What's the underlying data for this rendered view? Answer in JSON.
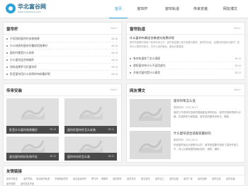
{
  "site": {
    "title": "华北富谷网",
    "url": "www.huabeiwai.com"
  },
  "nav": [
    "首页",
    "窗帘杆",
    "窗帘轨道",
    "传来安装",
    "网友博文"
  ],
  "panels": {
    "top_left": {
      "title": "窗帘杆",
      "more": "More+",
      "items": [
        {
          "text": "不同顶的窗帘杆安装效果",
          "date": "08-15"
        },
        {
          "text": "什么材质的窗帘杆最耐用效果好",
          "date": "08-15"
        },
        {
          "text": "窗帘杆都是什么材质",
          "date": "08-15"
        },
        {
          "text": "什么窗帘适合伸缩杆",
          "date": "08-14"
        },
        {
          "text": "如何选择罗马杆窗帘杆",
          "date": "08-14"
        },
        {
          "text": "卧室窗帘用什么材质的布料最好呢",
          "date": "08-13"
        }
      ]
    },
    "top_right": {
      "title": "窗帘轨道",
      "more": "More+",
      "featured_title": "什么窗帘布最适合做遮光效果好呢",
      "featured_excerpt": "窗帘的重要作用除了装饰作用之外，我们家还要以遮光效果为要求，窗帘的功能，还要如何选遮光窗帘？是你可以更好的遮光，也可以保护隐私，避免光照直接...",
      "items": [
        {
          "text": "卷帘轨道除了怎么清理",
          "date": "08-14"
        },
        {
          "text": "遮阳窗帘布什么不适用遮光",
          "date": "08-14"
        },
        {
          "text": "开放式窗帘是什么意思",
          "date": "08-13"
        }
      ]
    },
    "bottom_left": {
      "title": "传来安装",
      "more": "More+",
      "thumbs": [
        {
          "caption": "卧室什么窗帘效果最好",
          "date": "08-13"
        },
        {
          "caption": "窗帘杆窗帘杆怎么安装",
          "date": "08-11"
        },
        {
          "caption": "遮光窗帘的好处和坏处",
          "date": "08-12"
        },
        {
          "caption": "窗帘布帘杆怎么装",
          "date": "08-11"
        }
      ]
    },
    "bottom_right": {
      "title": "网友博文",
      "more": "More+",
      "posts": [
        {
          "title": "窗帘帘布怎么洗",
          "date": "更新时间：2021-08-17",
          "excerpt": "装修工作选择在选房的楼盘都会带有阳台，窗帘的选择是家中必备。在选购时为家庭装，窗帘选材要考虑采光、隔音..."
        },
        {
          "title": "什么窗帘适合适家装最好的",
          "date": "更新时间：2021-08-12",
          "excerpt": "卧室窗帘适合大家都可以的，窗帘的重要作用除了装饰作用之外，可以为家庭提供隐私保护，遮阳，隔热..."
        }
      ]
    }
  },
  "links": {
    "title": "友情链接",
    "items": [
      "窗帘杆批发",
      "窗帘导轨",
      "电动窗帘轨道",
      "不锈钢窗帘杆",
      "铝合金窗帘杆",
      "罗马杆",
      "伸缩杆",
      "窗帘配件",
      "窗帘布艺",
      "遮光窗帘",
      "窗帘加工",
      "窗帘定做",
      "窗帘厂家",
      "窗帘品牌",
      "窗帘清洗",
      "窗帘安装",
      "窗帘维修",
      "窗帘批发市场"
    ]
  },
  "colors": {
    "accent": "#2a9fd6",
    "background": "#f3f3f3"
  }
}
